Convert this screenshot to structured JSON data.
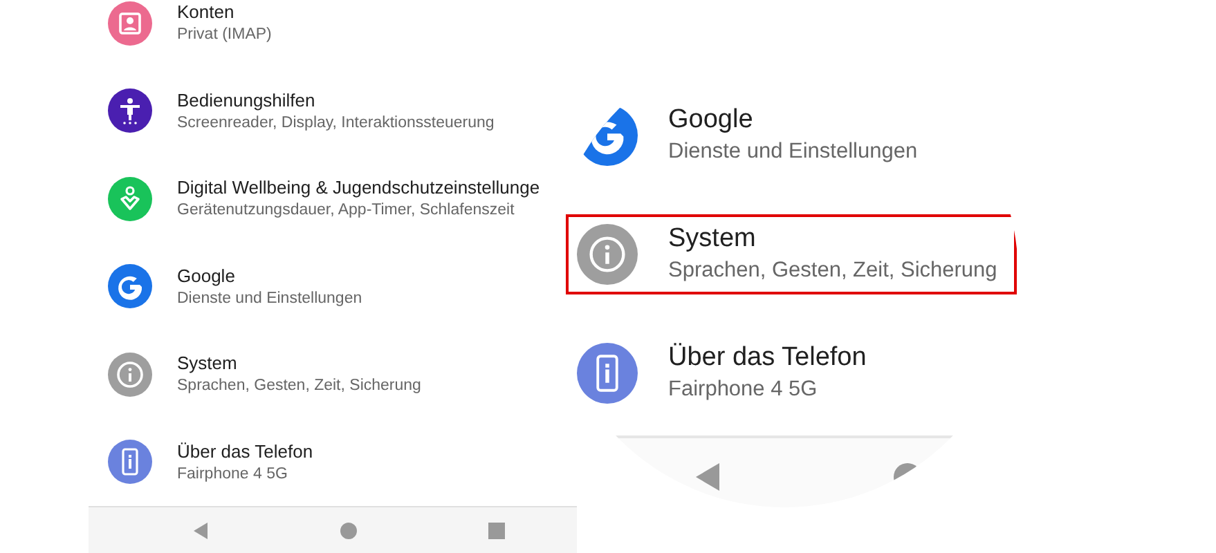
{
  "settings_list": {
    "items": [
      {
        "title": "Konten",
        "subtitle": "Privat (IMAP)"
      },
      {
        "title": "Bedienungshilfen",
        "subtitle": "Screenreader, Display, Interaktionssteuerung"
      },
      {
        "title": "Digital Wellbeing & Jugendschutzeinstellunge",
        "subtitle": "Gerätenutzungsdauer, App-Timer, Schlafenszeit"
      },
      {
        "title": "Google",
        "subtitle": "Dienste und Einstellungen"
      },
      {
        "title": "System",
        "subtitle": "Sprachen, Gesten, Zeit, Sicherung"
      },
      {
        "title": "Über das Telefon",
        "subtitle": "Fairphone 4 5G"
      }
    ]
  },
  "nav_bar": {
    "buttons": [
      {
        "kind": "back"
      },
      {
        "kind": "home"
      },
      {
        "kind": "recents"
      }
    ]
  },
  "magnifier": {
    "items": [
      {
        "title": "Google",
        "subtitle": "Dienste und Einstellungen",
        "selected": false
      },
      {
        "title": "System",
        "subtitle": "Sprachen, Gesten, Zeit, Sicherung",
        "selected": true
      },
      {
        "title": "Über das Telefon",
        "subtitle": "Fairphone 4 5G",
        "selected": false
      }
    ],
    "nav_buttons": [
      {
        "kind": "back"
      },
      {
        "kind": "home"
      }
    ]
  }
}
